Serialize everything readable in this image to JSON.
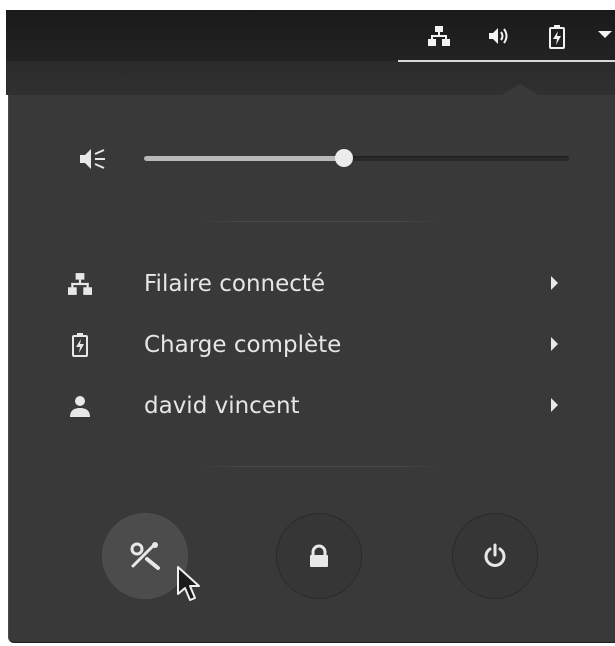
{
  "panel": {
    "tray": [
      "network-wired-icon",
      "speaker-icon",
      "battery-charging-icon",
      "dropdown-arrow-icon"
    ]
  },
  "volume": {
    "icon": "speaker-muted-icon",
    "level": 0.47
  },
  "menu": {
    "items": [
      {
        "label": "Filaire connecté",
        "icon": "network-wired-icon"
      },
      {
        "label": "Charge complète",
        "icon": "battery-charging-icon"
      },
      {
        "label": "david vincent",
        "icon": "user-icon"
      }
    ]
  },
  "actions": [
    "settings-icon",
    "lock-icon",
    "power-icon"
  ],
  "colors": {
    "popup": "#393939",
    "text": "#e6e6e6",
    "topbar": "#1a1a1a"
  }
}
